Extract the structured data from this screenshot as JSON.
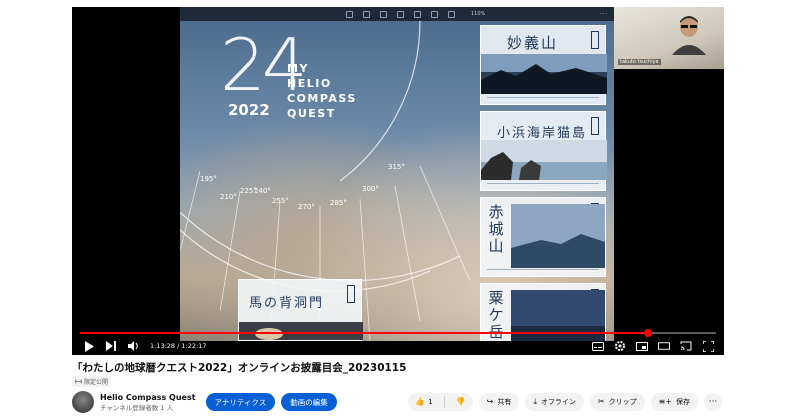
{
  "poster": {
    "big_number": "24",
    "year": "2022",
    "title_lines": [
      "MY",
      "HELIO",
      "COMPASS",
      "QUEST"
    ],
    "compass_degrees": [
      "195°",
      "210°",
      "225°",
      "240°",
      "255°",
      "270°",
      "285°",
      "300°",
      "315°"
    ],
    "cards": [
      {
        "name": "妙義山",
        "orientation": "h"
      },
      {
        "name": "小浜海岸猫島",
        "orientation": "h"
      },
      {
        "name": "赤城山",
        "orientation": "v"
      },
      {
        "name": "粟ケ岳",
        "orientation": "v"
      },
      {
        "name": "馬の背洞門",
        "orientation": "h"
      }
    ]
  },
  "viewer": {
    "zoom": "110%"
  },
  "webcam": {
    "participant_name": "takuto tsuchiya"
  },
  "player": {
    "current_time": "1:13:28",
    "duration": "1:22:17",
    "progress": 0.893,
    "colors": {
      "progress": "#ff0000"
    }
  },
  "video": {
    "title": "「わたしの地球暦クエスト2022」オンラインお披露目会_20230115",
    "visibility": "限定公開"
  },
  "channel": {
    "name": "Helio Compass Quest",
    "subscribers": "チャンネル登録者数 1 人"
  },
  "buttons": {
    "analytics": "アナリティクス",
    "edit_video": "動画の編集",
    "like_count": "1",
    "share": "共有",
    "offline": "オフライン",
    "clip": "クリップ",
    "save": "保存"
  }
}
